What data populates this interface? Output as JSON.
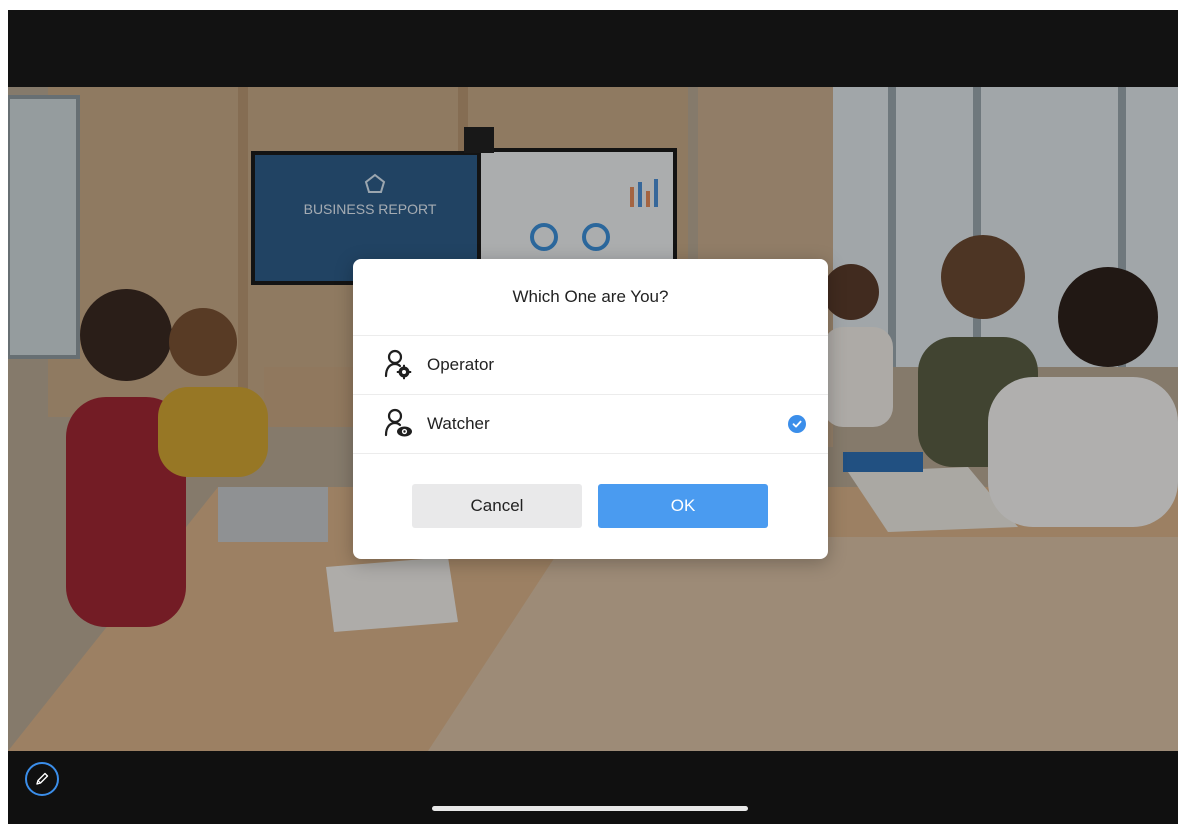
{
  "screen": {
    "background_image": "conference-room-photo",
    "display_left": {
      "icon": "pentagon-icon",
      "title": "BUSINESS REPORT"
    },
    "display_right": {
      "icon": "dashboard-charts"
    }
  },
  "dialog": {
    "title": "Which One are You?",
    "options": [
      {
        "label": "Operator",
        "icon": "user-gear-icon",
        "selected": false
      },
      {
        "label": "Watcher",
        "icon": "user-eye-icon",
        "selected": true
      }
    ],
    "cancel_label": "Cancel",
    "ok_label": "OK"
  },
  "toolbar": {
    "pen_icon": "pen-icon"
  },
  "colors": {
    "accent": "#3b8eea",
    "ok_button": "#4a9bf0",
    "cancel_button": "#e9e9ea",
    "bars": "#111111"
  }
}
